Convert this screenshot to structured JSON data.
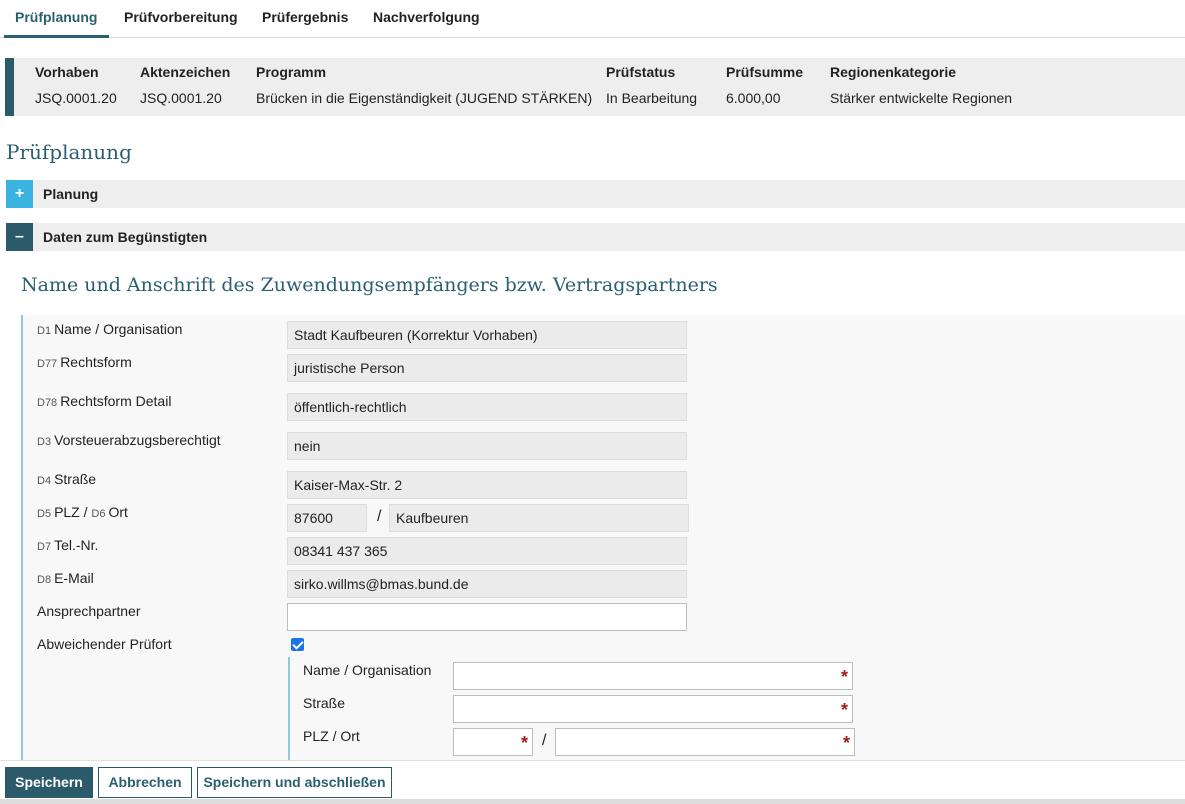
{
  "tabs": [
    "Prüfplanung",
    "Prüfvorbereitung",
    "Prüfergebnis",
    "Nachverfolgung"
  ],
  "summary": {
    "columns": [
      {
        "header": "Vorhaben",
        "value": "JSQ.0001.20"
      },
      {
        "header": "Aktenzeichen",
        "value": "JSQ.0001.20"
      },
      {
        "header": "Programm",
        "value": "Brücken in die Eigenständigkeit (JUGEND STÄRKEN)"
      },
      {
        "header": "Prüfstatus",
        "value": "In Bearbeitung"
      },
      {
        "header": "Prüfsumme",
        "value": "6.000,00"
      },
      {
        "header": "Regionenkategorie",
        "value": "Stärker entwickelte Regionen"
      }
    ]
  },
  "page_title": "Prüfplanung",
  "accordion": {
    "planung": {
      "icon": "+",
      "label": "Planung"
    },
    "daten": {
      "icon": "–",
      "label": "Daten zum Begünstigten"
    }
  },
  "section_title": "Name und Anschrift des Zuwendungsempfängers bzw. Vertragspartners",
  "form": {
    "name": {
      "code": "D1",
      "label": "Name / Organisation",
      "value": "Stadt Kaufbeuren (Korrektur Vorhaben)"
    },
    "rechtsform": {
      "code": "D77",
      "label": "Rechtsform",
      "value": "juristische Person"
    },
    "rechtsform_detail": {
      "code": "D78",
      "label": "Rechtsform Detail",
      "value": "öffentlich-rechtlich"
    },
    "vorsteuer": {
      "code": "D3",
      "label": "Vorsteuerabzugsberechtigt",
      "value": "nein"
    },
    "strasse": {
      "code": "D4",
      "label": "Straße",
      "value": "Kaiser-Max-Str. 2"
    },
    "plz_ort": {
      "code_plz": "D5",
      "label_plz": "PLZ",
      "sep": "/",
      "code_ort": "D6",
      "label_ort": "Ort",
      "plz": "87600",
      "ort": "Kaufbeuren"
    },
    "tel": {
      "code": "D7",
      "label": "Tel.-Nr.",
      "value": "08341 437 365"
    },
    "email": {
      "code": "D8",
      "label": "E-Mail",
      "value": "sirko.willms@bmas.bund.de"
    },
    "ansprechpartner": {
      "label": "Ansprechpartner",
      "value": ""
    },
    "abweichender_pruefort": {
      "label": "Abweichender Prüfort",
      "checked": true
    }
  },
  "pruefort": {
    "name_label": "Name / Organisation",
    "strasse_label": "Straße",
    "plz_ort_label": "PLZ / Ort",
    "slash": "/",
    "required_mark": "*"
  },
  "buttons": {
    "save": "Speichern",
    "cancel": "Abbrechen",
    "save_close": "Speichern und abschließen"
  },
  "colors": {
    "primary": "#2b5b6b",
    "accent_light": "#3bb3e0",
    "required": "#9c1c1c"
  }
}
